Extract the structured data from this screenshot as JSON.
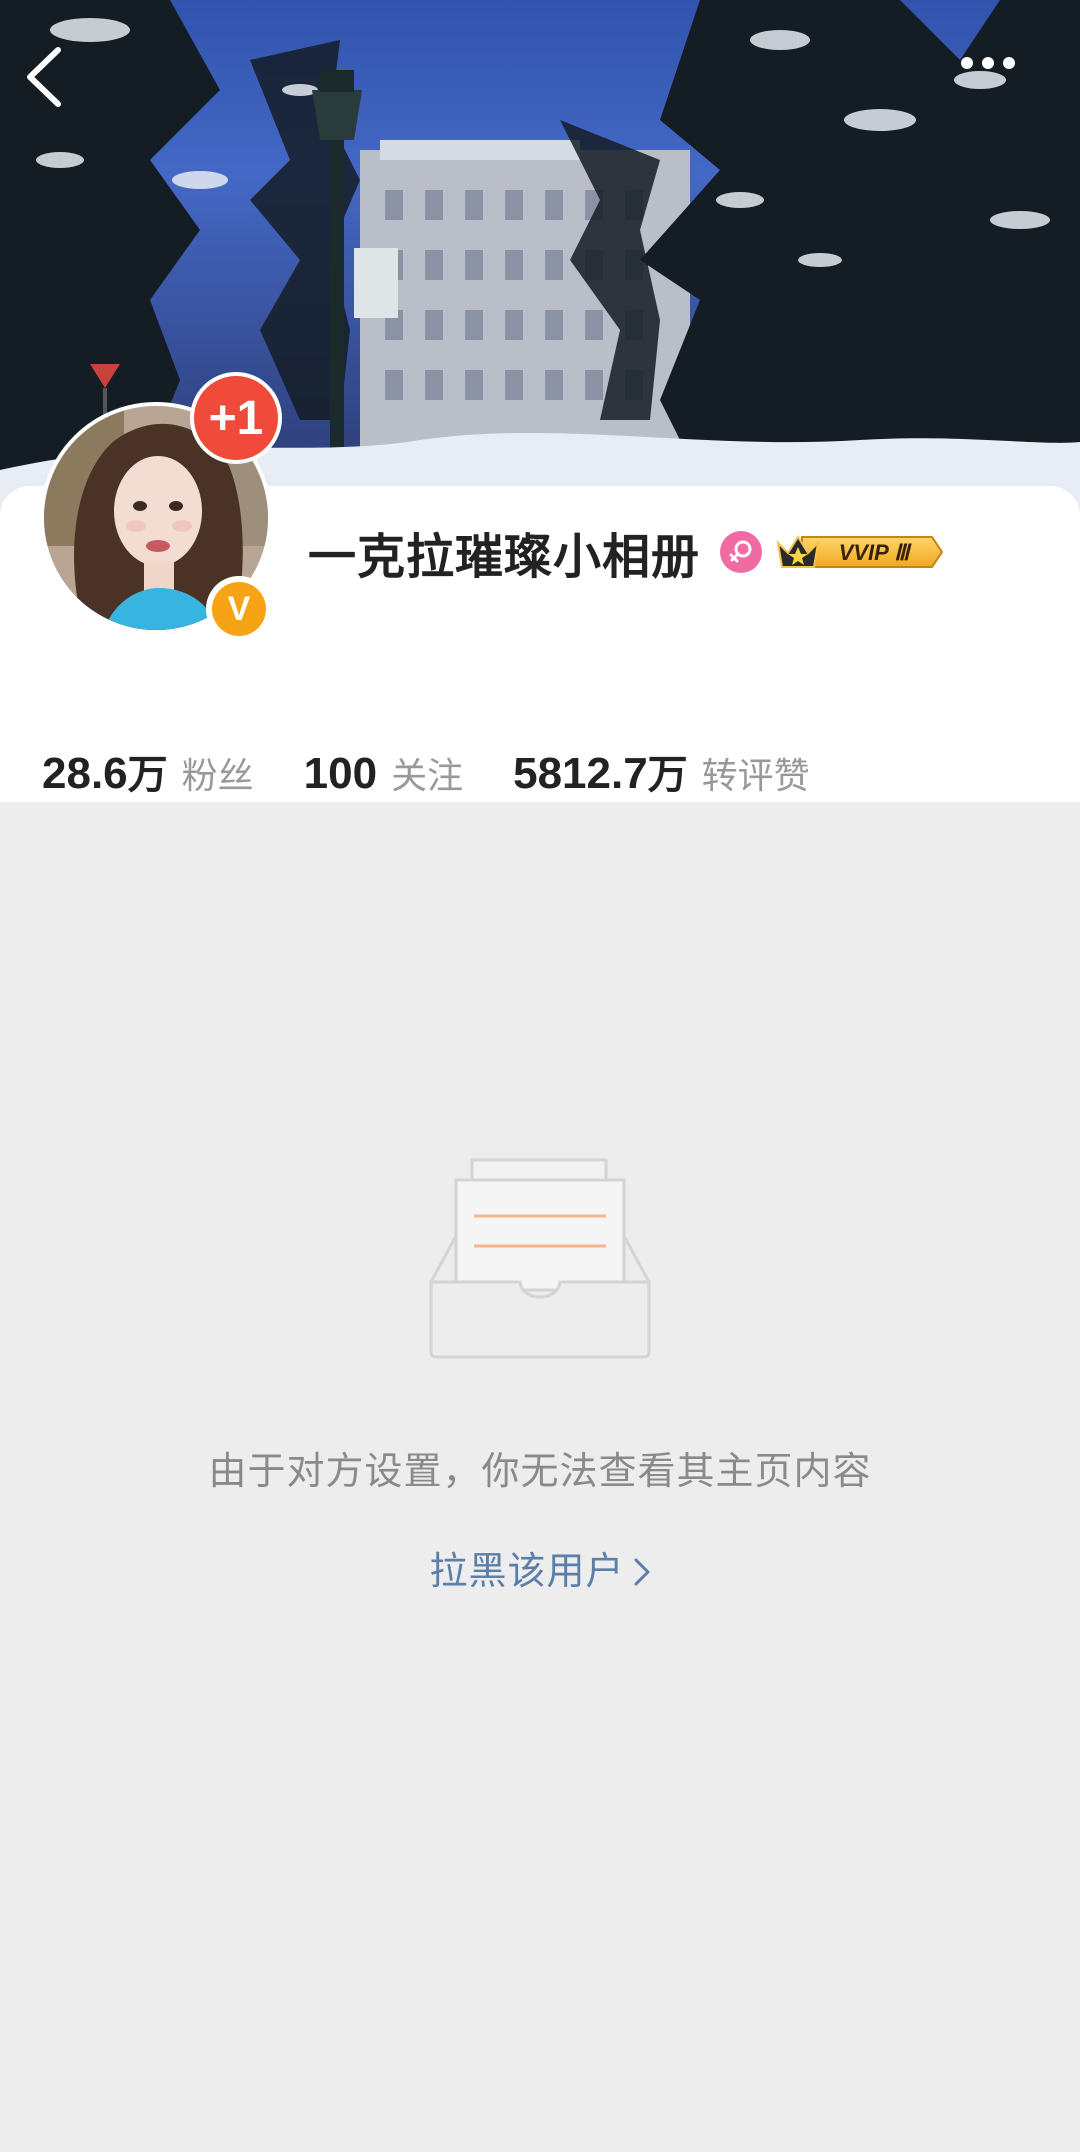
{
  "header": {
    "back_icon": "chevron-left-icon",
    "more_icon": "more-dots-icon"
  },
  "profile": {
    "name": "一克拉璀璨小相册",
    "plus_badge": "+1",
    "verify_letter": "V",
    "vip_badge": "VVIP Ⅲ",
    "gender_icon": "female-icon",
    "stats": [
      {
        "number": "28.6",
        "unit": "万",
        "label": "粉丝"
      },
      {
        "number": "100",
        "unit": "",
        "label": "关注"
      },
      {
        "number": "5812.7",
        "unit": "万",
        "label": "转评赞"
      }
    ]
  },
  "empty_state": {
    "icon": "empty-inbox-icon",
    "message": "由于对方设置，你无法查看其主页内容",
    "block_link": "拉黑该用户"
  },
  "colors": {
    "background": "#ededed",
    "card": "#ffffff",
    "accent_link": "#5c7fa8",
    "badge_red": "#f04a3a",
    "verify_orange": "#f7a316",
    "gender_pink": "#f06aa4"
  }
}
